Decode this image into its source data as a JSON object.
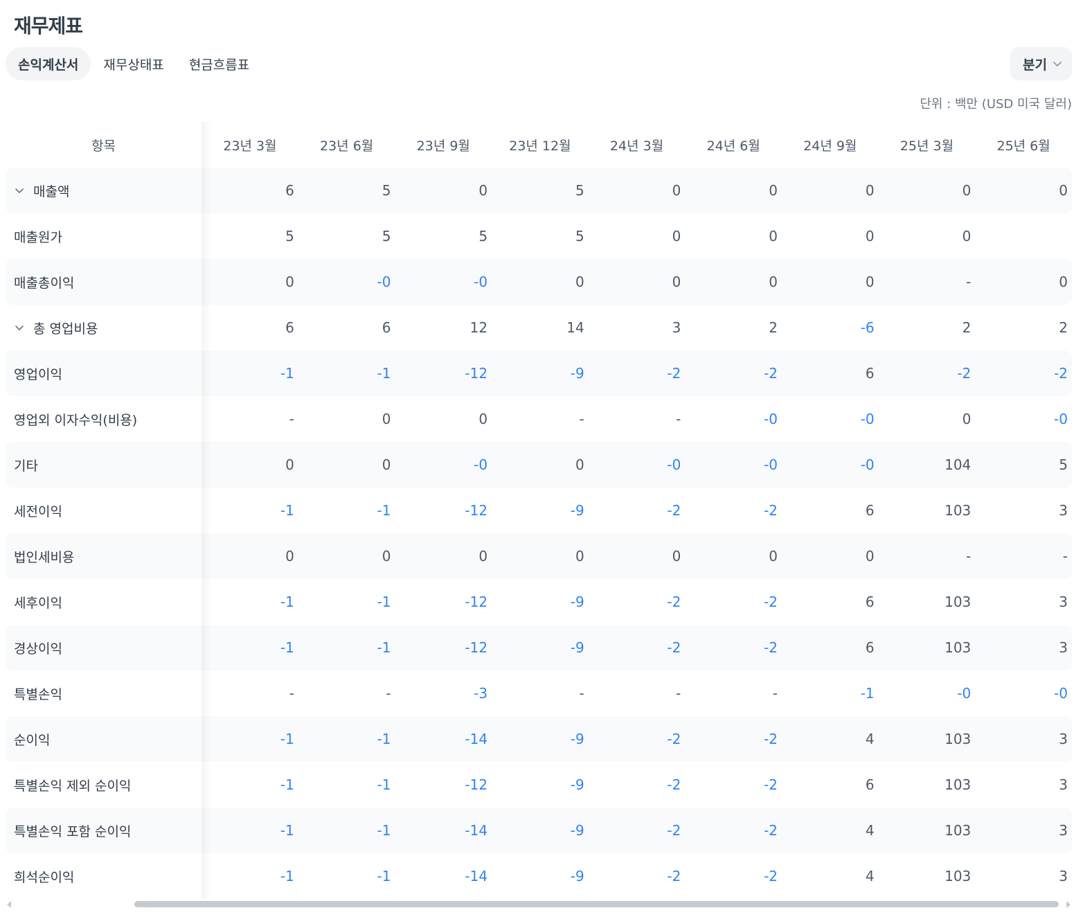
{
  "page": {
    "title": "재무제표"
  },
  "tabs": [
    {
      "label": "손익계산서",
      "active": true
    },
    {
      "label": "재무상태표",
      "active": false
    },
    {
      "label": "현금흐름표",
      "active": false
    }
  ],
  "period_select": {
    "value": "분기"
  },
  "unit_note": "단위 : 백만 (USD 미국 달러)",
  "table": {
    "header_label": "항목",
    "columns": [
      "23년 3월",
      "23년 6월",
      "23년 9월",
      "23년 12월",
      "24년 3월",
      "24년 6월",
      "24년 9월",
      "25년 3월",
      "25년 6월"
    ],
    "rows": [
      {
        "label": "매출액",
        "expandable": true,
        "values": [
          "6",
          "5",
          "0",
          "5",
          "0",
          "0",
          "0",
          "0",
          "0"
        ]
      },
      {
        "label": "매출원가",
        "expandable": false,
        "values": [
          "5",
          "5",
          "5",
          "5",
          "0",
          "0",
          "0",
          "0",
          ""
        ]
      },
      {
        "label": "매출총이익",
        "expandable": false,
        "values": [
          "0",
          "-0",
          "-0",
          "0",
          "0",
          "0",
          "0",
          "-",
          "0"
        ]
      },
      {
        "label": "총 영업비용",
        "expandable": true,
        "values": [
          "6",
          "6",
          "12",
          "14",
          "3",
          "2",
          "-6",
          "2",
          "2"
        ]
      },
      {
        "label": "영업이익",
        "expandable": false,
        "values": [
          "-1",
          "-1",
          "-12",
          "-9",
          "-2",
          "-2",
          "6",
          "-2",
          "-2"
        ]
      },
      {
        "label": "영업외 이자수익(비용)",
        "expandable": false,
        "values": [
          "-",
          "0",
          "0",
          "-",
          "-",
          "-0",
          "-0",
          "0",
          "-0"
        ]
      },
      {
        "label": "기타",
        "expandable": false,
        "values": [
          "0",
          "0",
          "-0",
          "0",
          "-0",
          "-0",
          "-0",
          "104",
          "5"
        ]
      },
      {
        "label": "세전이익",
        "expandable": false,
        "values": [
          "-1",
          "-1",
          "-12",
          "-9",
          "-2",
          "-2",
          "6",
          "103",
          "3"
        ]
      },
      {
        "label": "법인세비용",
        "expandable": false,
        "values": [
          "0",
          "0",
          "0",
          "0",
          "0",
          "0",
          "0",
          "-",
          "-"
        ]
      },
      {
        "label": "세후이익",
        "expandable": false,
        "values": [
          "-1",
          "-1",
          "-12",
          "-9",
          "-2",
          "-2",
          "6",
          "103",
          "3"
        ]
      },
      {
        "label": "경상이익",
        "expandable": false,
        "values": [
          "-1",
          "-1",
          "-12",
          "-9",
          "-2",
          "-2",
          "6",
          "103",
          "3"
        ]
      },
      {
        "label": "특별손익",
        "expandable": false,
        "values": [
          "-",
          "-",
          "-3",
          "-",
          "-",
          "-",
          "-1",
          "-0",
          "-0"
        ]
      },
      {
        "label": "순이익",
        "expandable": false,
        "values": [
          "-1",
          "-1",
          "-14",
          "-9",
          "-2",
          "-2",
          "4",
          "103",
          "3"
        ]
      },
      {
        "label": "특별손익 제외 순이익",
        "expandable": false,
        "values": [
          "-1",
          "-1",
          "-12",
          "-9",
          "-2",
          "-2",
          "6",
          "103",
          "3"
        ]
      },
      {
        "label": "특별손익 포함 순이익",
        "expandable": false,
        "values": [
          "-1",
          "-1",
          "-14",
          "-9",
          "-2",
          "-2",
          "4",
          "103",
          "3"
        ]
      },
      {
        "label": "희석순이익",
        "expandable": false,
        "values": [
          "-1",
          "-1",
          "-14",
          "-9",
          "-2",
          "-2",
          "4",
          "103",
          "3"
        ]
      }
    ]
  },
  "colors": {
    "negative": "#3182f6",
    "text": "#333d4b",
    "muted": "#6b7684",
    "row_alt_bg": "#f9fafb",
    "tab_active_bg": "#f2f4f6"
  },
  "icons": {
    "expand": "chevron-down-icon",
    "select": "chevron-down-icon"
  }
}
